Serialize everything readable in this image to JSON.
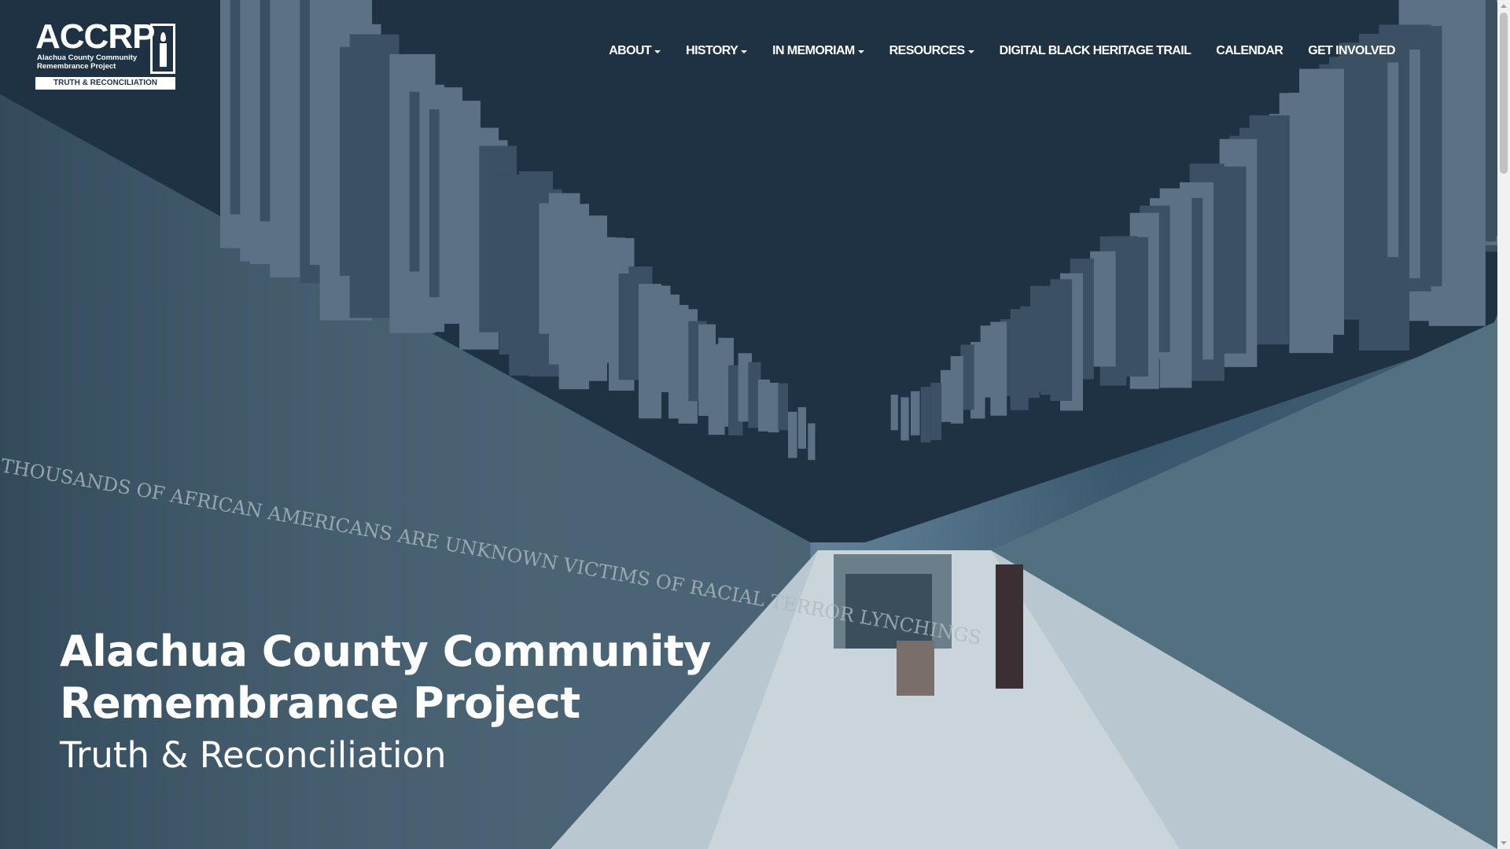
{
  "site": {
    "logo": {
      "acronym": "ACCRP",
      "name_lines": [
        "Alachua County Community",
        "Remembrance Project"
      ],
      "tagline": "TRUTH & RECONCILIATION"
    },
    "nav": [
      {
        "label": "ABOUT",
        "dropdown": true
      },
      {
        "label": "HISTORY",
        "dropdown": true
      },
      {
        "label": "IN MEMORIAM",
        "dropdown": true
      },
      {
        "label": "RESOURCES",
        "dropdown": true
      },
      {
        "label": "DIGITAL BLACK HERITAGE TRAIL",
        "dropdown": false
      },
      {
        "label": "CALENDAR",
        "dropdown": false
      },
      {
        "label": "GET INVOLVED",
        "dropdown": false
      }
    ]
  },
  "hero": {
    "title_line1": "Alachua County Community",
    "title_line2": "Remembrance Project",
    "subtitle": "Truth & Reconciliation",
    "wall_inscription": "THOUSANDS OF AFRICAN AMERICANS ARE UNKNOWN VICTIMS OF RACIAL TERROR LYNCHINGS"
  },
  "colors": {
    "overlay": "#1c3346",
    "text": "#ffffff",
    "scrollbar_track": "#f1f1f1",
    "scrollbar_thumb": "#c1c1c1"
  }
}
